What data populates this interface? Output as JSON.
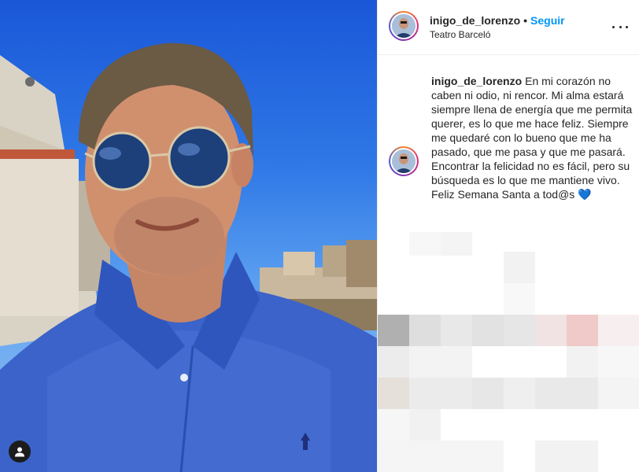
{
  "post": {
    "username": "inigo_de_lorenzo",
    "follow_label": "Seguir",
    "separator": "•",
    "location": "Teatro Barceló"
  },
  "caption": {
    "username": "inigo_de_lorenzo",
    "line1": "En mi corazón no caben ni odio, ni rencor. Mi alma estará siempre llena de energía que me permita querer, es lo que me hace feliz. Siempre me quedaré con lo bueno que me ha pasado, que me pasa y que me pasará.",
    "line2": "Encontrar la felicidad no es fácil, pero su búsqueda es lo que me mantiene vivo.",
    "line3": "Feliz Semana Santa a tod@s",
    "emoji": "💙"
  },
  "icons": {
    "more": "more-options-icon",
    "tag": "user-tag-icon",
    "heart": "blue-heart-emoji"
  },
  "colors": {
    "accent": "#0095f6",
    "text": "#262626",
    "sky": "#2f78e6",
    "shirt": "#3b63c9"
  }
}
